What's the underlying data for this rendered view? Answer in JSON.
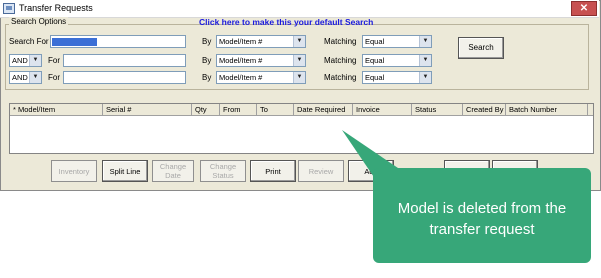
{
  "window": {
    "title": "Transfer Requests",
    "close_glyph": "✕"
  },
  "search": {
    "group_label": "Search Options",
    "default_link": "Click here to make this your default Search",
    "search_for_label": "Search For",
    "for_label": "For",
    "by_label": "By",
    "matching_label": "Matching",
    "rows": [
      {
        "logic": "",
        "by": "Model/Item #",
        "matching": "Equal"
      },
      {
        "logic": "AND",
        "by": "Model/Item #",
        "matching": "Equal"
      },
      {
        "logic": "AND",
        "by": "Model/Item #",
        "matching": "Equal"
      }
    ],
    "button_label": "Search"
  },
  "grid": {
    "columns": [
      "* Model/Item",
      "Serial #",
      "Qty",
      "From",
      "To",
      "Date Required",
      "Invoice",
      "Status",
      "Created By",
      "Batch Number"
    ]
  },
  "buttons": [
    {
      "label": "Inventory",
      "enabled": false
    },
    {
      "label": "Split Line",
      "enabled": true
    },
    {
      "label": "Change Date",
      "enabled": false
    },
    {
      "label": "Change Status",
      "enabled": false
    },
    {
      "label": "Print",
      "enabled": true
    },
    {
      "label": "Review",
      "enabled": false
    },
    {
      "label": "Add",
      "enabled": true
    }
  ],
  "callout": {
    "text": "Model is deleted from the transfer request",
    "color": "#37a779"
  },
  "colors": {
    "link": "#1a1adf",
    "window_bg": "#ece9d8",
    "selection": "#3b6fd6"
  }
}
